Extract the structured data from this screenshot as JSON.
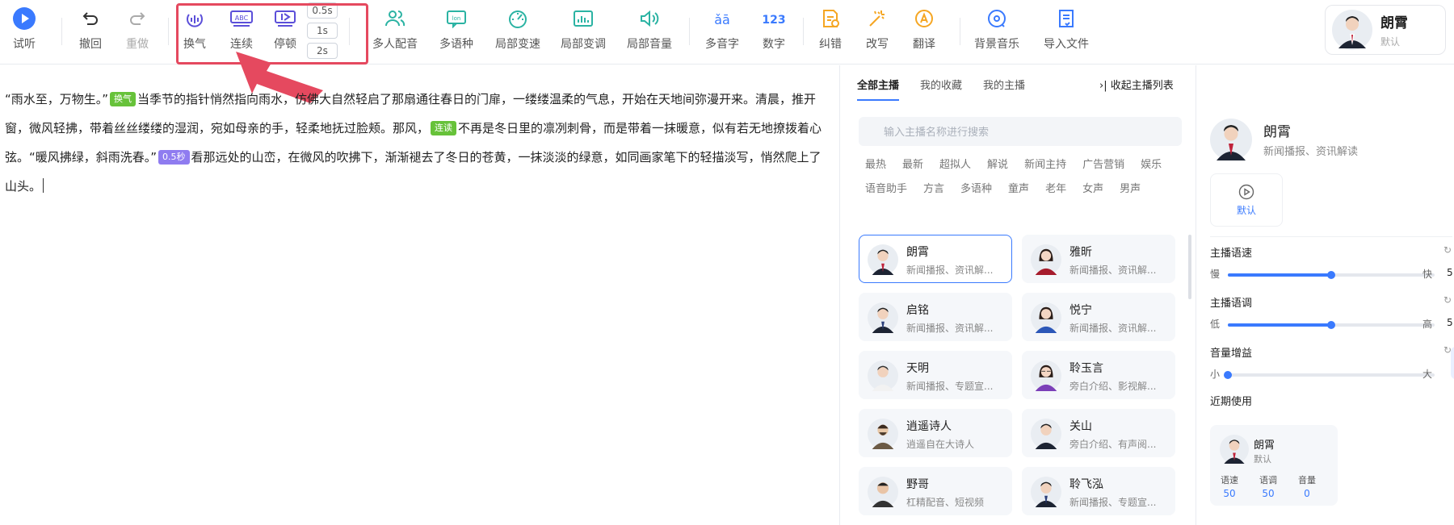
{
  "toolbar": {
    "audition": "试听",
    "undo": "撤回",
    "redo": "重做",
    "breath": "换气",
    "continuous": "连续",
    "pause": "停顿",
    "pause_opts": [
      "0.5s",
      "1s",
      "2s"
    ],
    "multi_voice": "多人配音",
    "multi_lang": "多语种",
    "local_speed": "局部变速",
    "local_pitch": "局部变调",
    "local_volume": "局部音量",
    "polyphone": "多音字",
    "number": "数字",
    "proofread": "纠错",
    "rewrite": "改写",
    "translate": "翻译",
    "bgm": "背景音乐",
    "import": "导入文件"
  },
  "user": {
    "name": "朗霄",
    "sub": "默认"
  },
  "editor": {
    "seg1": "“雨水至，万物生。”",
    "tag1": "换气",
    "seg2": "当季节的指针悄然指向雨水，仿佛大自然轻启了那扇通往春日的门扉，一缕缕温柔的气息，开始在天地间弥漫开来。清晨，推开窗，微风轻拂，带着丝丝缕缕的湿润，宛如母亲的手，轻柔地抚过脸颊。那风，",
    "tag2": "连读",
    "seg3": "不再是冬日里的凛冽刺骨，而是带着一抹暖意，似有若无地撩拨着心弦。“暖风拂绿，斜雨洗春。”",
    "tag3": "0.5秒",
    "seg4": "看那远处的山峦，在微风的吹拂下，渐渐褪去了冬日的苍黄，一抹淡淡的绿意，如同画家笔下的轻描淡写，悄然爬上了山头。"
  },
  "anchors": {
    "tabs": [
      "全部主播",
      "我的收藏",
      "我的主播"
    ],
    "collapse": "›| 收起主播列表",
    "search_placeholder": "输入主播名称进行搜索",
    "categories": [
      "最热",
      "最新",
      "超拟人",
      "解说",
      "新闻主持",
      "广告营销",
      "娱乐",
      "语音助手",
      "方言",
      "多语种",
      "童声",
      "老年",
      "女声",
      "男声"
    ],
    "cards": [
      {
        "name": "朗霄",
        "desc": "新闻播报、资讯解..."
      },
      {
        "name": "雅昕",
        "desc": "新闻播报、资讯解..."
      },
      {
        "name": "启铭",
        "desc": "新闻播报、资讯解..."
      },
      {
        "name": "悦宁",
        "desc": "新闻播报、资讯解..."
      },
      {
        "name": "天明",
        "desc": "新闻播报、专题宣..."
      },
      {
        "name": "聆玉言",
        "desc": "旁白介绍、影视解..."
      },
      {
        "name": "逍遥诗人",
        "desc": "逍遥自在大诗人"
      },
      {
        "name": "关山",
        "desc": "旁白介绍、有声阅..."
      },
      {
        "name": "野哥",
        "desc": "杠精配音、短视频"
      },
      {
        "name": "聆飞泓",
        "desc": "新闻播报、专题宣..."
      }
    ]
  },
  "detail": {
    "name": "朗霄",
    "desc": "新闻播报、资讯解读",
    "play_label": "默认",
    "speed": {
      "title": "主播语速",
      "min": "慢",
      "max": "快",
      "value": 0.5,
      "value_cut": "5"
    },
    "pitch": {
      "title": "主播语调",
      "min": "低",
      "max": "高",
      "value": 0.5,
      "value_cut": "5"
    },
    "volume": {
      "title": "音量增益",
      "min": "小",
      "max": "大",
      "value": 0.0
    },
    "recent_title": "近期使用",
    "recent": {
      "name": "朗霄",
      "sub": "默认",
      "k1": "语速",
      "v1": "50",
      "k2": "语调",
      "v2": "50",
      "k3": "音量",
      "v3": "0"
    }
  },
  "colors": {
    "accent": "#3a7afe",
    "teal": "#2bb3a3",
    "orange": "#f5a623",
    "highlight": "#e5495f"
  }
}
